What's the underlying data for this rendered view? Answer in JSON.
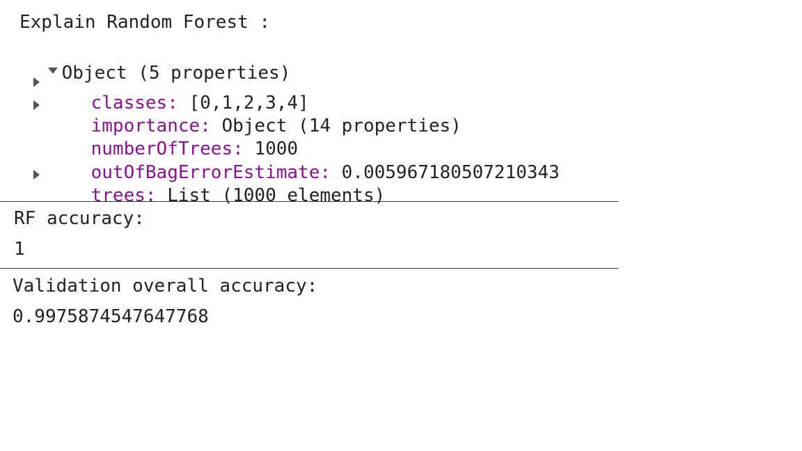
{
  "console": {
    "title": "Explain Random Forest :",
    "object_summary": "Object (5 properties)",
    "properties": [
      {
        "key": "classes:",
        "value": " [0,1,2,3,4]",
        "expandable": true
      },
      {
        "key": "importance:",
        "value": " Object (14 properties)",
        "expandable": true
      },
      {
        "key": "numberOfTrees:",
        "value": " 1000",
        "expandable": false
      },
      {
        "key": "outOfBagErrorEstimate:",
        "value": " 0.005967180507210343",
        "expandable": false
      },
      {
        "key": "trees:",
        "value": " List (1000 elements)",
        "expandable": true
      }
    ],
    "rf_accuracy_label": "RF accuracy:",
    "rf_accuracy_value": "1",
    "validation_label": "Validation overall accuracy:",
    "validation_value": "0.9975874547647768"
  },
  "colors": {
    "property_key": "#881391",
    "text": "#222222"
  },
  "icons": {
    "expanded": "triangle-down-icon",
    "collapsed": "triangle-right-icon"
  }
}
